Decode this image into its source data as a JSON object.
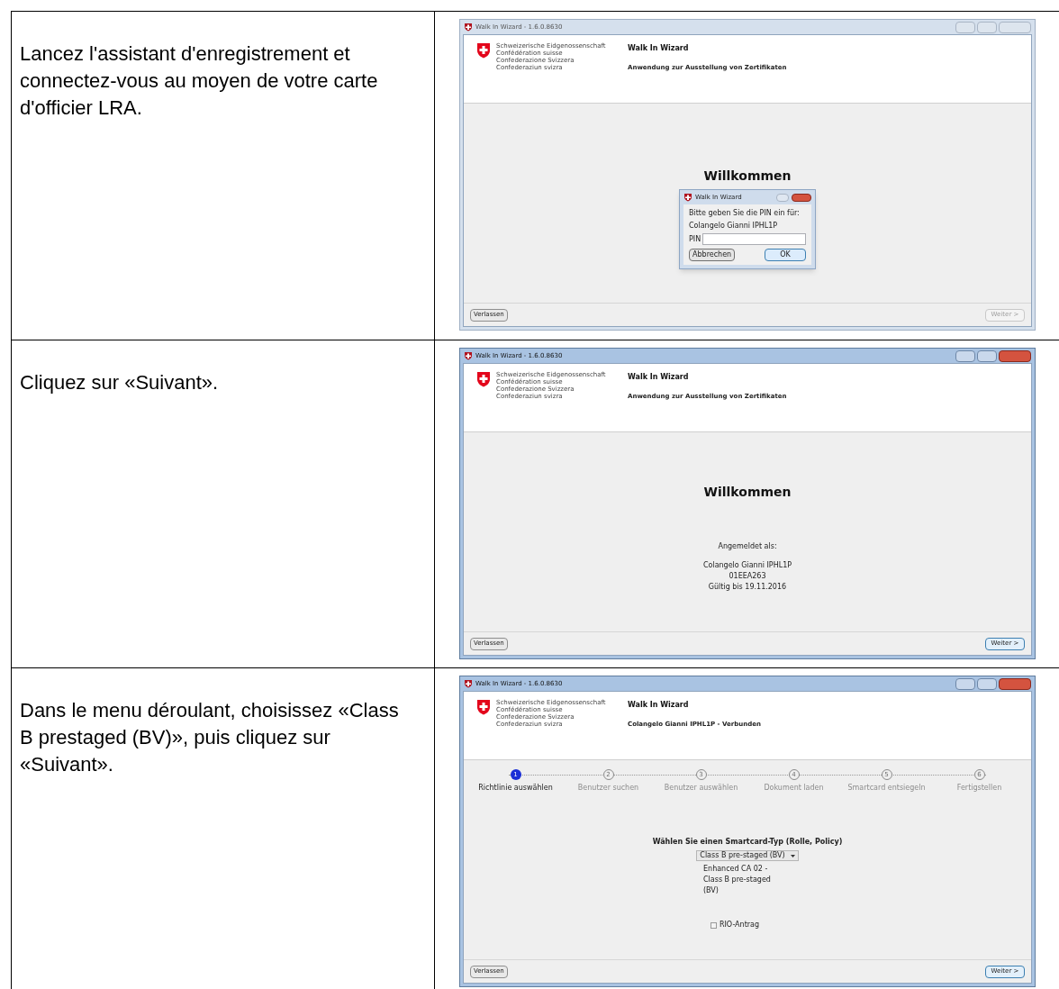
{
  "steps": [
    {
      "instruction": "Lancez l'assistant d'enregistrement et connectez-vous au moyen de votre carte d'officier LRA.",
      "window": {
        "kind": "pin",
        "active": false,
        "title": "Walk In Wizard - 1.6.0.8630",
        "org_lines": [
          "Schweizerische Eidgenossenschaft",
          "Confédération suisse",
          "Confederazione Svizzera",
          "Confederaziun svizra"
        ],
        "app_title": "Walk In Wizard",
        "subtitle": "Anwendung zur Ausstellung von Zertifikaten",
        "heading": "Willkommen",
        "dialog": {
          "title": "Walk In Wizard",
          "prompt": "Bitte geben Sie die PIN ein für:",
          "name": "Colangelo Gianni IPHL1P",
          "field_label": "PIN",
          "cancel": "Abbrechen",
          "ok": "OK"
        },
        "exit_button": "Verlassen",
        "next_button": {
          "label": "Weiter >",
          "disabled": true
        }
      }
    },
    {
      "instruction": "Cliquez sur «Suivant».",
      "window": {
        "kind": "info",
        "active": true,
        "title": "Walk In Wizard - 1.6.0.8630",
        "org_lines": [
          "Schweizerische Eidgenossenschaft",
          "Confédération suisse",
          "Confederazione Svizzera",
          "Confederaziun svizra"
        ],
        "app_title": "Walk In Wizard",
        "subtitle": "Anwendung zur Ausstellung von Zertifikaten",
        "heading": "Willkommen",
        "logged_in_label": "Angemeldet als:",
        "info_lines": [
          "Colangelo Gianni IPHL1P",
          "01EEA263",
          "Gültig bis 19.11.2016"
        ],
        "exit_button": "Verlassen",
        "next_button": {
          "label": "Weiter >",
          "disabled": false
        }
      }
    },
    {
      "instruction": "Dans le menu déroulant, choisissez «Class B prestaged (BV)», puis cliquez sur «Suivant».",
      "window": {
        "kind": "wizard",
        "active": true,
        "title": "Walk In Wizard - 1.6.0.8630",
        "org_lines": [
          "Schweizerische Eidgenossenschaft",
          "Confédération suisse",
          "Confederazione Svizzera",
          "Confederaziun svizra"
        ],
        "app_title": "Walk In Wizard",
        "subtitle": "Colangelo Gianni IPHL1P - Verbunden",
        "stepper": [
          {
            "number": "1",
            "label": "Richtlinie auswählen",
            "selected": true
          },
          {
            "number": "2",
            "label": "Benutzer suchen",
            "selected": false
          },
          {
            "number": "3",
            "label": "Benutzer auswählen",
            "selected": false
          },
          {
            "number": "4",
            "label": "Dokument laden",
            "selected": false
          },
          {
            "number": "5",
            "label": "Smartcard entsiegeln",
            "selected": false
          },
          {
            "number": "6",
            "label": "Fertigstellen",
            "selected": false
          }
        ],
        "prompt": "Wählen Sie einen Smartcard-Typ (Rolle, Policy)",
        "dropdown": "Class B pre-staged (BV)",
        "description": "Enhanced CA 02 - Class B pre-staged (BV)",
        "checkbox": {
          "label": "RIO-Antrag",
          "checked": false
        },
        "exit_button": "Verlassen",
        "next_button": {
          "label": "Weiter >",
          "disabled": false
        }
      }
    }
  ]
}
